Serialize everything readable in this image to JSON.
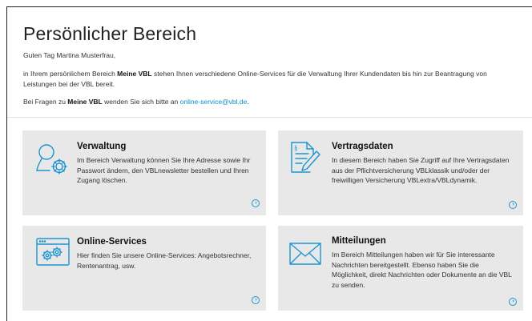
{
  "page": {
    "title": "Persönlicher Bereich",
    "greeting": "Guten Tag  Martina Musterfrau,",
    "intro_pre": "in Ihrem persönlichem Bereich ",
    "intro_brand": "Meine VBL",
    "intro_post": " stehen Ihnen verschiedene Online-Services für die Verwaltung Ihrer Kundendaten bis hin zur Beantragung von Leistungen bei der VBL bereit.",
    "faq_pre": "Bei Fragen zu ",
    "faq_brand": "Meine VBL",
    "faq_mid": " wenden Sie sich bitte an ",
    "faq_email": "online-service@vbl.de",
    "faq_post": "."
  },
  "cards": {
    "verwaltung": {
      "title": "Verwaltung",
      "text": "Im Bereich Verwaltung können Sie Ihre Adresse sowie Ihr Passwort ändern, den VBLnewsletter bestellen und Ihren Zugang löschen.",
      "icon": "user-settings-icon"
    },
    "vertragsdaten": {
      "title": "Vertragsdaten",
      "text": "In diesem Bereich haben Sie Zugriff auf Ihre Vertragsdaten aus der Pflichtversicherung VBLklassik und/oder der freiwilligen Versicherung VBLextra/VBLdynamik.",
      "icon": "document-edit-icon"
    },
    "online_services": {
      "title": "Online-Services",
      "text": "Hier finden Sie unsere Online-Services: Angebotsrechner, Rentenantrag, usw.",
      "icon": "browser-gears-icon"
    },
    "mitteilungen": {
      "title": "Mitteilungen",
      "text": "Im Bereich Mitteilungen haben wir für Sie interessante Nachrichten bereitgestellt. Ebenso haben Sie die Möglichkeit, direkt Nachrichten oder Dokumente an die VBL zu senden.",
      "icon": "envelope-icon"
    }
  },
  "colors": {
    "accent": "#1a95d2",
    "card_bg": "#e8e8e8",
    "link": "#0a8fc8"
  }
}
